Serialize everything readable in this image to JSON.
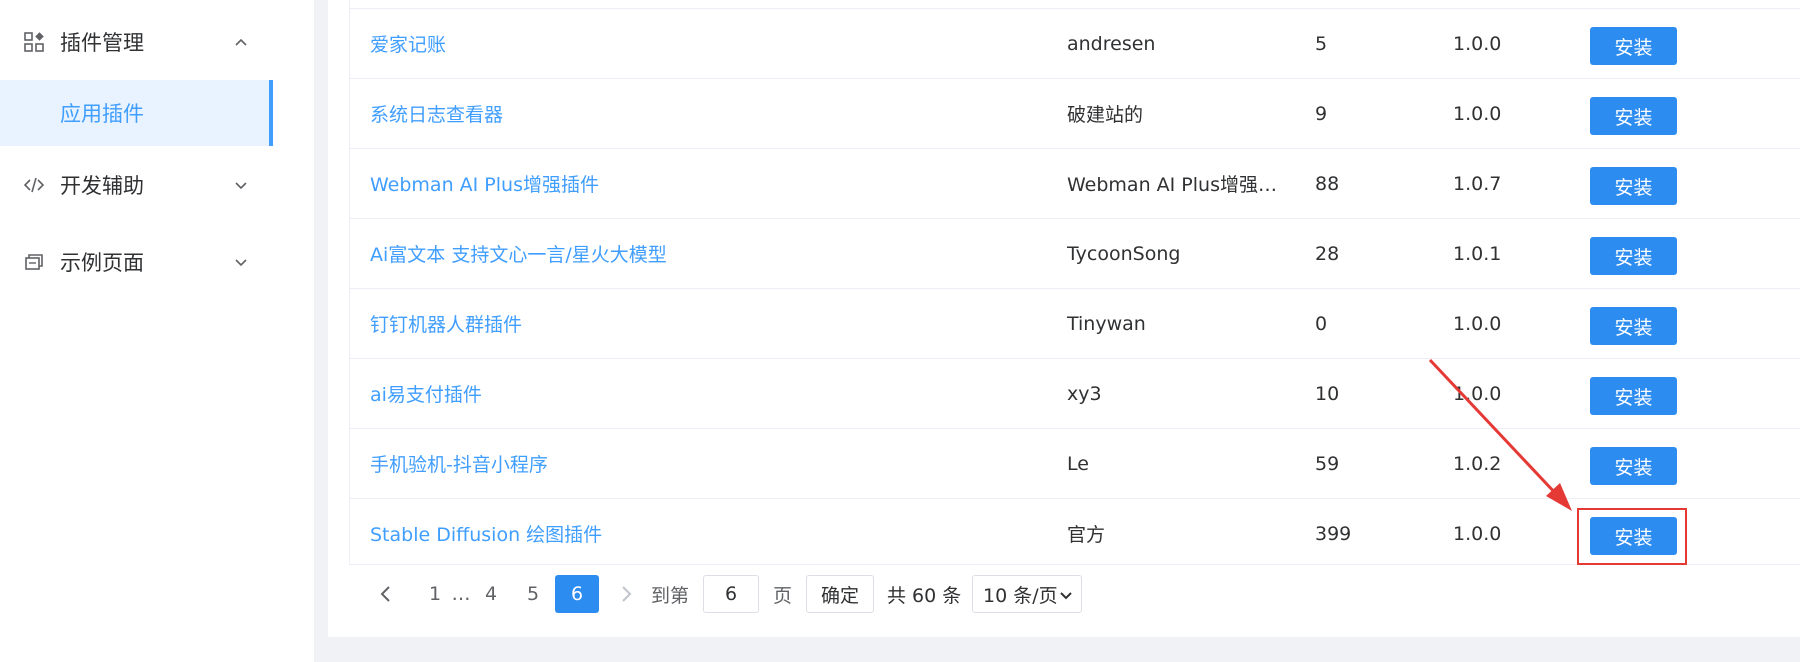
{
  "sidebar": {
    "menu": [
      {
        "label": "插件管理",
        "icon": "apps-icon",
        "expanded": true
      },
      {
        "label": "开发辅助",
        "icon": "code-icon",
        "expanded": false
      },
      {
        "label": "示例页面",
        "icon": "pages-icon",
        "expanded": false
      }
    ],
    "submenu_active": "应用插件"
  },
  "table": {
    "rows": [
      {
        "name": "爱家记账",
        "author": "andresen",
        "downloads": "5",
        "version": "1.0.0",
        "action": "安装"
      },
      {
        "name": "系统日志查看器",
        "author": "破建站的",
        "downloads": "9",
        "version": "1.0.0",
        "action": "安装"
      },
      {
        "name": "Webman AI Plus增强插件",
        "author": "Webman AI Plus增强…",
        "downloads": "88",
        "version": "1.0.7",
        "action": "安装"
      },
      {
        "name": "Ai富文本 支持文心一言/星火大模型",
        "author": "TycoonSong",
        "downloads": "28",
        "version": "1.0.1",
        "action": "安装"
      },
      {
        "name": "钉钉机器人群插件",
        "author": "Tinywan",
        "downloads": "0",
        "version": "1.0.0",
        "action": "安装"
      },
      {
        "name": "ai易支付插件",
        "author": "xy3",
        "downloads": "10",
        "version": "1.0.0",
        "action": "安装"
      },
      {
        "name": "手机验机-抖音小程序",
        "author": "Le",
        "downloads": "59",
        "version": "1.0.2",
        "action": "安装"
      },
      {
        "name": "Stable Diffusion 绘图插件",
        "author": "官方",
        "downloads": "399",
        "version": "1.0.0",
        "action": "安装"
      }
    ]
  },
  "pagination": {
    "pages": [
      "1",
      "…",
      "4",
      "5",
      "6"
    ],
    "current": "6",
    "goto_prefix": "到第",
    "goto_value": "6",
    "goto_suffix": "页",
    "confirm": "确定",
    "total": "共 60 条",
    "page_size": "10 条/页"
  },
  "colors": {
    "accent": "#409eff",
    "button": "#2d8cf0",
    "highlight": "#e53935"
  }
}
